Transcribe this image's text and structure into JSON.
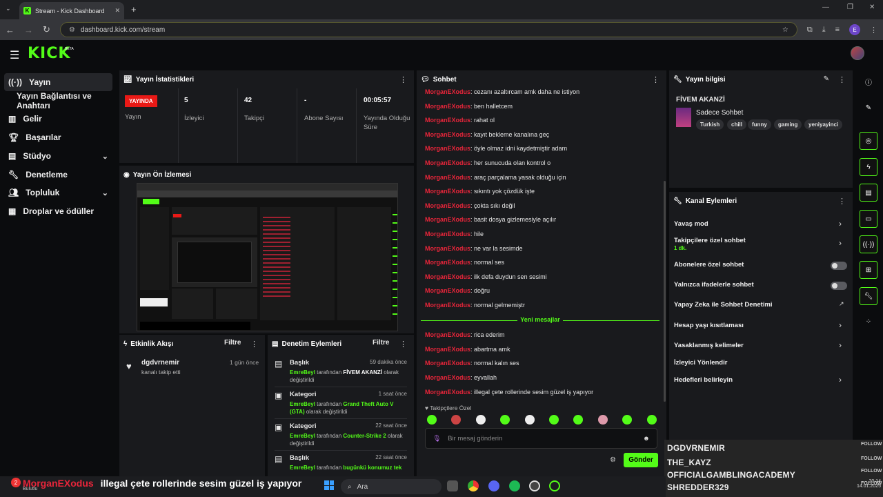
{
  "browser": {
    "tab_title": "Stream - Kick Dashboard",
    "url": "dashboard.kick.com/stream",
    "profile_letter": "E"
  },
  "header": {
    "logo": "KICK",
    "logo_badge": "BETA"
  },
  "sidebar": {
    "items": [
      {
        "label": "Yayın",
        "icon": "broadcast-icon"
      },
      {
        "label": "Yayın Bağlantısı ve Anahtarı",
        "icon": ""
      },
      {
        "label": "Gelir",
        "icon": "chart-icon"
      },
      {
        "label": "Başarılar",
        "icon": "trophy-icon"
      },
      {
        "label": "Stüdyo",
        "icon": "studio-icon"
      },
      {
        "label": "Denetleme",
        "icon": "wrench-icon"
      },
      {
        "label": "Topluluk",
        "icon": "people-icon"
      },
      {
        "label": "Droplar ve ödüller",
        "icon": "gift-icon"
      }
    ]
  },
  "stats": {
    "title": "Yayın İstatistikleri",
    "live_badge": "YAYINDA",
    "status_label": "Yayın",
    "viewers_value": "5",
    "viewers_label": "İzleyici",
    "followers_value": "42",
    "followers_label": "Takipçi",
    "subs_value": "-",
    "subs_label": "Abone Sayısı",
    "duration_value": "00:05:57",
    "duration_label": "Yayında Olduğu Süre"
  },
  "preview": {
    "title": "Yayın Ön İzlemesi"
  },
  "activity": {
    "title": "Etkinlik Akışı",
    "filter": "Filtre",
    "items": [
      {
        "user": "dgdvrnemir",
        "time": "1 gün önce",
        "text": "kanalı takip etti"
      }
    ]
  },
  "moderation": {
    "title": "Denetim Eylemleri",
    "filter": "Filtre",
    "items": [
      {
        "type": "Başlık",
        "time": "59 dakika önce",
        "actor": "EmreBeyl",
        "mid": " tarafından ",
        "target": "FİVEM AKANZİ",
        "suffix": " olarak değiştirildi"
      },
      {
        "type": "Kategori",
        "time": "1 saat önce",
        "actor": "EmreBeyl",
        "mid": " tarafından ",
        "target": "Grand Theft Auto V (GTA)",
        "suffix": " olarak değiştirildi"
      },
      {
        "type": "Kategori",
        "time": "22 saat önce",
        "actor": "EmreBeyl",
        "mid": " tarafından ",
        "target": "Counter-Strike 2",
        "suffix": " olarak değiştirildi"
      },
      {
        "type": "Başlık",
        "time": "22 saat önce",
        "actor": "EmreBeyl",
        "mid": " tarafından ",
        "target": "bugünkü konumuz tek",
        "suffix": ""
      }
    ]
  },
  "chat": {
    "title": "Sohbet",
    "user": "MorganEXodus",
    "messages": [
      "cezanı azaltırcam amk daha ne istiyon",
      "ben halletcem",
      "rahat ol",
      "kayıt bekleme kanalına geç",
      "öyle olmaz idni kaydetmiştir adam",
      "her sunucuda olan kontrol o",
      "araç parçalama yasak olduğu için",
      "sıkıntı yok çözdük işte",
      "çokta sıkı değil",
      "basit dosya gizlemesiyle açılır",
      "hile",
      "ne var la sesimde",
      "normal ses",
      "ilk defa duydun sen sesimi",
      "doğru",
      "normal gelmemiştr"
    ],
    "new_label": "Yeni mesajlar",
    "new_messages": [
      "rica ederim",
      "abartma amk",
      "normal kalın ses",
      "eyvallah",
      "illegal çete rollerinde sesim güzel iş yapıyor"
    ],
    "followers_only": "Takipçilere Özel",
    "placeholder": "Bir mesaj gönderin",
    "send": "Gönder"
  },
  "info": {
    "title": "Yayın bilgisi",
    "stream_title": "FİVEM AKANZİ",
    "category": "Sadece Sohbet",
    "tags": [
      "Turkish",
      "chill",
      "funny",
      "gaming",
      "yeniyayinci"
    ]
  },
  "channel_actions": {
    "title": "Kanal Eylemleri",
    "items": [
      {
        "label": "Yavaş mod",
        "control": "chevron"
      },
      {
        "label": "Takipçilere özel sohbet",
        "sub": "1 dk.",
        "control": "chevron"
      },
      {
        "label": "Abonelere özel sohbet",
        "control": "toggle",
        "on": false
      },
      {
        "label": "Yalnızca ifadelerle sohbet",
        "control": "toggle",
        "on": false
      },
      {
        "label": "Yapay Zeka ile Sohbet Denetimi",
        "control": "external"
      },
      {
        "label": "Hesap yaşı kısıtlaması",
        "control": "chevron"
      },
      {
        "label": "Yasaklanmış kelimeler",
        "control": "chevron"
      },
      {
        "label": "İzleyici Yönlendir",
        "control": "none"
      },
      {
        "label": "Hedefleri belirleyin",
        "control": "chevron"
      }
    ]
  },
  "follow_overlay": {
    "names": [
      "DGDVRNEMIR",
      "THE_KAYZ",
      "OFFICIALGAMBLINGACADEMY",
      "SHREDDER329"
    ],
    "label": "FOLLOW"
  },
  "stream_overlay": {
    "user": "MorganEXodus",
    "text": "illegal çete rollerinde sesim güzel iş yapıyor"
  },
  "taskbar": {
    "weather_badge": "2",
    "weather_label": "Bulutlu",
    "search_placeholder": "Ara",
    "time": "20:14",
    "date": "14.01.2025"
  },
  "colors": {
    "accent": "#53fc18",
    "live": "#e91916",
    "chat_user": "#e8253a",
    "panel": "#191a1d"
  }
}
